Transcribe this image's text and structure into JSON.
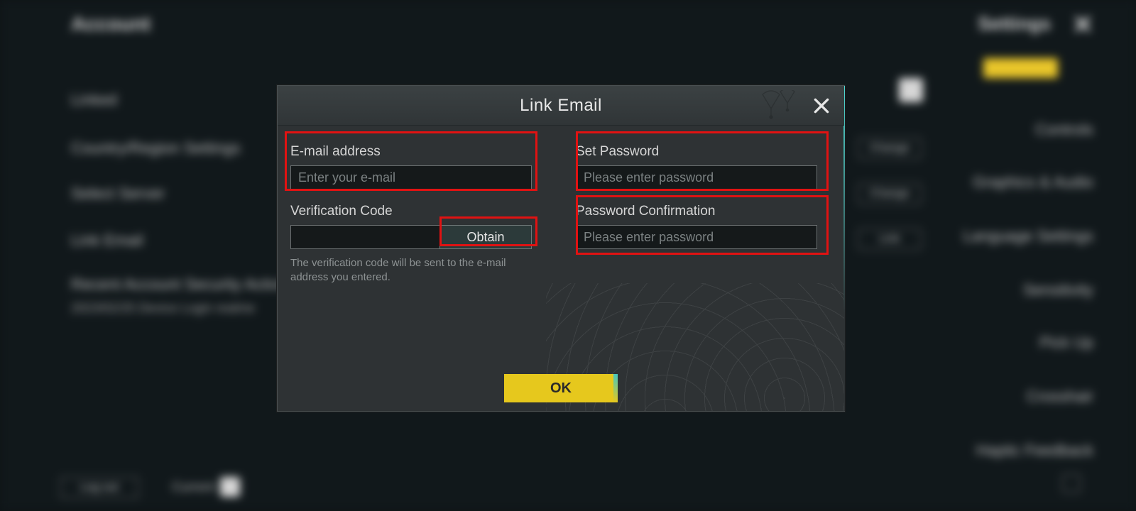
{
  "background": {
    "header_left": "Account",
    "header_right_title": "Settings",
    "header_close_glyph": "✕",
    "left_menu": {
      "linked": "Linked",
      "region": "Country/Region Settings",
      "server": "Select Server",
      "link_email": "Link Email",
      "security": "Recent Account Security Activity",
      "security_line": "2023/02/25  Device Login  realme"
    },
    "right_buttons": {
      "change1": "Change",
      "change2": "Change",
      "link": "Link"
    },
    "side_tabs": {
      "controls": "Controls",
      "graphics": "Graphics & Audio",
      "language": "Language Settings",
      "sensitivity": "Sensitivity",
      "pickup": "Pick Up",
      "crosshair": "Crosshair",
      "feedback": "Haptic Feedback"
    },
    "footer": {
      "logout": "Log out",
      "current": "Current"
    }
  },
  "modal": {
    "title": "Link Email",
    "email_label": "E-mail address",
    "email_placeholder": "Enter your e-mail",
    "code_label": "Verification Code",
    "obtain_label": "Obtain",
    "code_hint": "The verification code will be sent to the e-mail address you entered.",
    "password_label": "Set Password",
    "password_placeholder": "Please enter password",
    "confirm_label": "Password Confirmation",
    "confirm_placeholder": "Please enter password",
    "ok_label": "OK"
  }
}
